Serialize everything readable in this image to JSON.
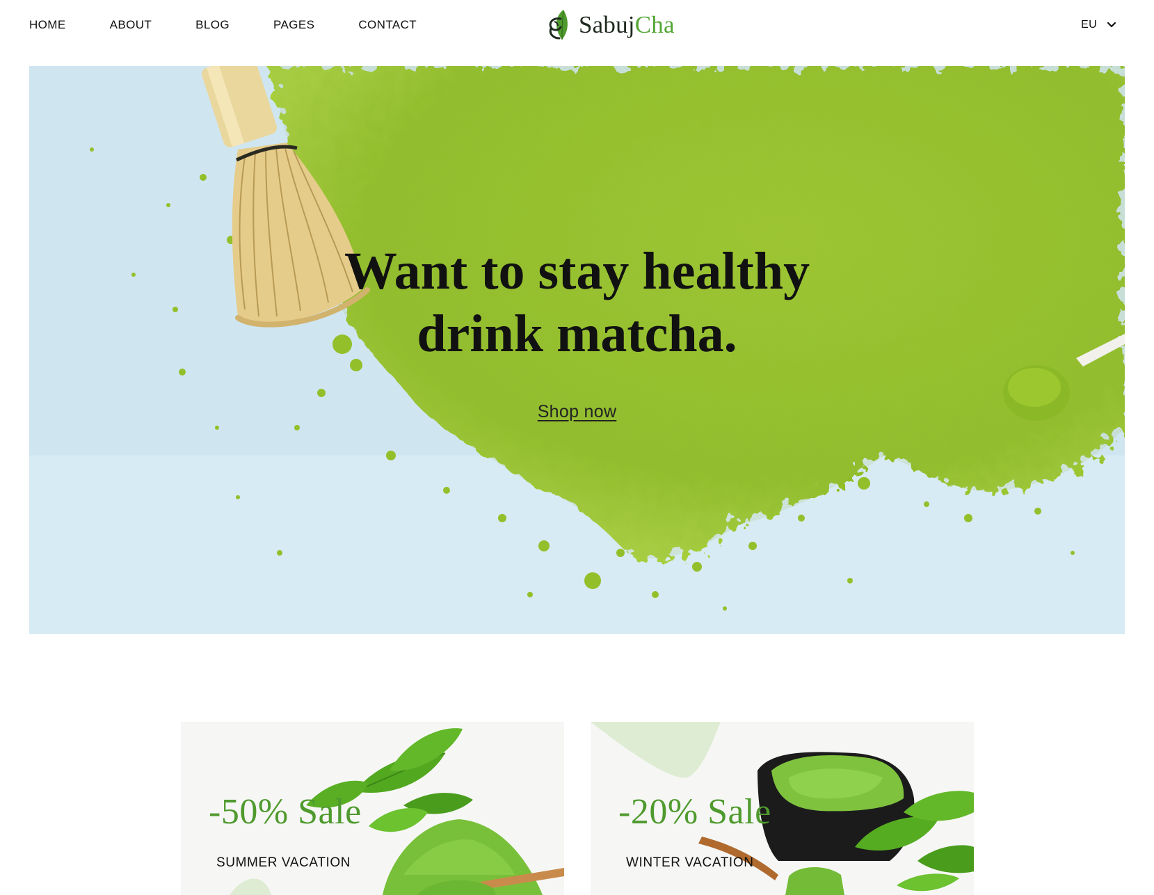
{
  "header": {
    "nav": [
      {
        "label": "HOME"
      },
      {
        "label": "ABOUT"
      },
      {
        "label": "BLOG"
      },
      {
        "label": "PAGES"
      },
      {
        "label": "CONTACT"
      }
    ],
    "logo": {
      "part1": "Sabuj",
      "part2": "Cha"
    },
    "language": {
      "value": "EU",
      "icon": "chevron-down-icon"
    }
  },
  "hero": {
    "title_line1": "Want to stay healthy",
    "title_line2": "drink matcha.",
    "cta_label": "Shop now"
  },
  "promos": [
    {
      "title": "-50% Sale",
      "subtitle": "SUMMER VACATION"
    },
    {
      "title": "-20% Sale",
      "subtitle": "WINTER VACATION"
    }
  ],
  "colors": {
    "brand_green": "#53a635",
    "sale_green": "#4f9a2e",
    "matcha": "#97c42a",
    "hero_background": "#cfe6f1",
    "text": "#111111"
  }
}
